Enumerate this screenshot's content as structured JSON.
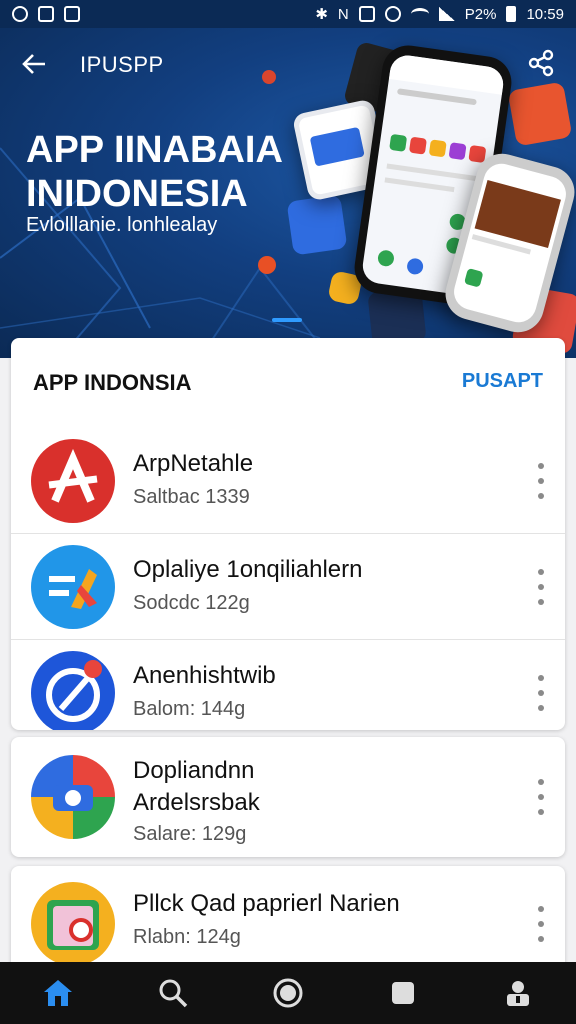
{
  "status_bar": {
    "battery_text": "P2%",
    "time": "10:59"
  },
  "header": {
    "title": "IPUSPP",
    "heading_line1": "APP IINABAIA",
    "heading_line2": "INIDONESIA",
    "subtitle": "Evlolllanie. lonhlealay"
  },
  "section": {
    "title": "APP INDONSIA",
    "action": "PUSAPT"
  },
  "apps": [
    {
      "name": "ArpNetahle",
      "meta": "Saltbac 1339"
    },
    {
      "name": "Oplaliye 1onqiliahlern",
      "meta": "Sodcdc 122g"
    },
    {
      "name": "Anenhishtwib",
      "meta": "Balom: 144g"
    },
    {
      "name": "Dopliandnn",
      "name2": "Ardelsrsbak",
      "meta": "Salare: 129g"
    },
    {
      "name": "Pllck Qad paprierl Narien",
      "meta": "Rlabn: 124g"
    }
  ],
  "colors": {
    "hero": "#123f80",
    "accent": "#1a7ad4",
    "nav_active": "#2b8ef0"
  },
  "icons": [
    "back-arrow-icon",
    "share-icon",
    "home-icon",
    "search-icon",
    "record-icon",
    "square-icon",
    "profile-icon"
  ]
}
